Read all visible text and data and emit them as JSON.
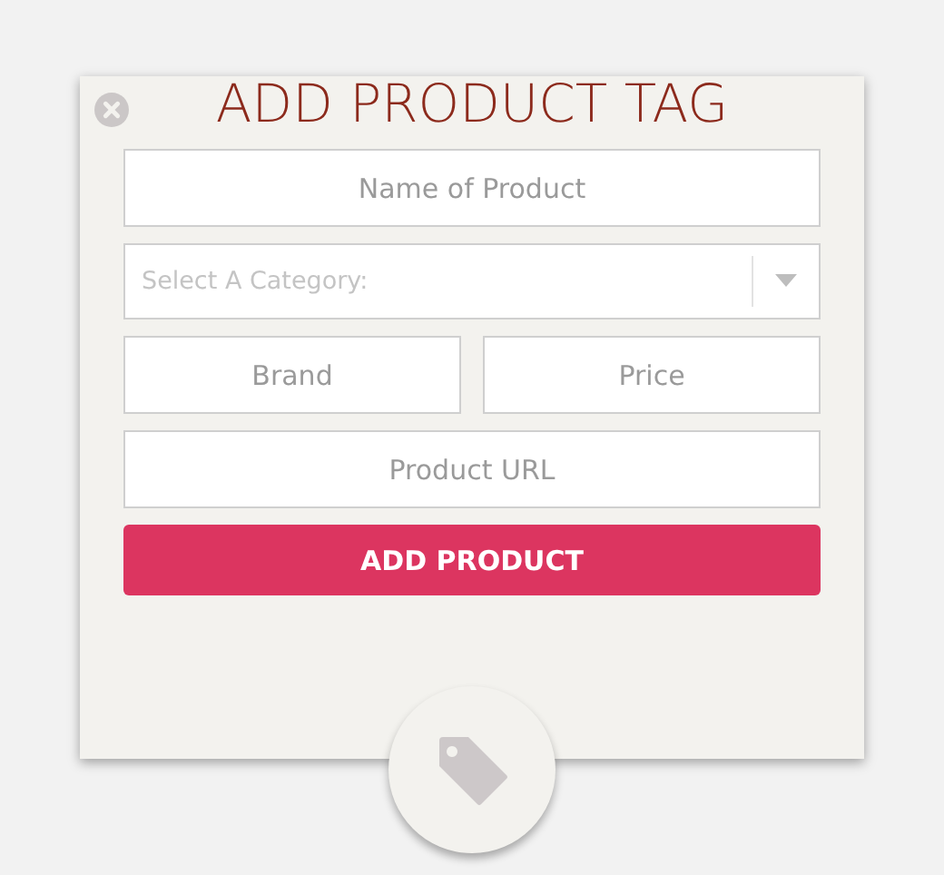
{
  "dialog": {
    "title": "ADD PRODUCT TAG",
    "rows": [
      {
        "fields": [
          {
            "kind": "text",
            "placeholder": "Name of Product"
          }
        ]
      },
      {
        "fields": [
          {
            "kind": "select",
            "placeholder": "Select A Category:"
          }
        ]
      },
      {
        "fields": [
          {
            "kind": "text",
            "placeholder": "Brand"
          },
          {
            "kind": "text",
            "placeholder": "Price"
          }
        ]
      },
      {
        "fields": [
          {
            "kind": "text",
            "placeholder": "Product URL"
          }
        ]
      }
    ],
    "submit_button": {
      "label": "ADD PRODUCT"
    }
  }
}
